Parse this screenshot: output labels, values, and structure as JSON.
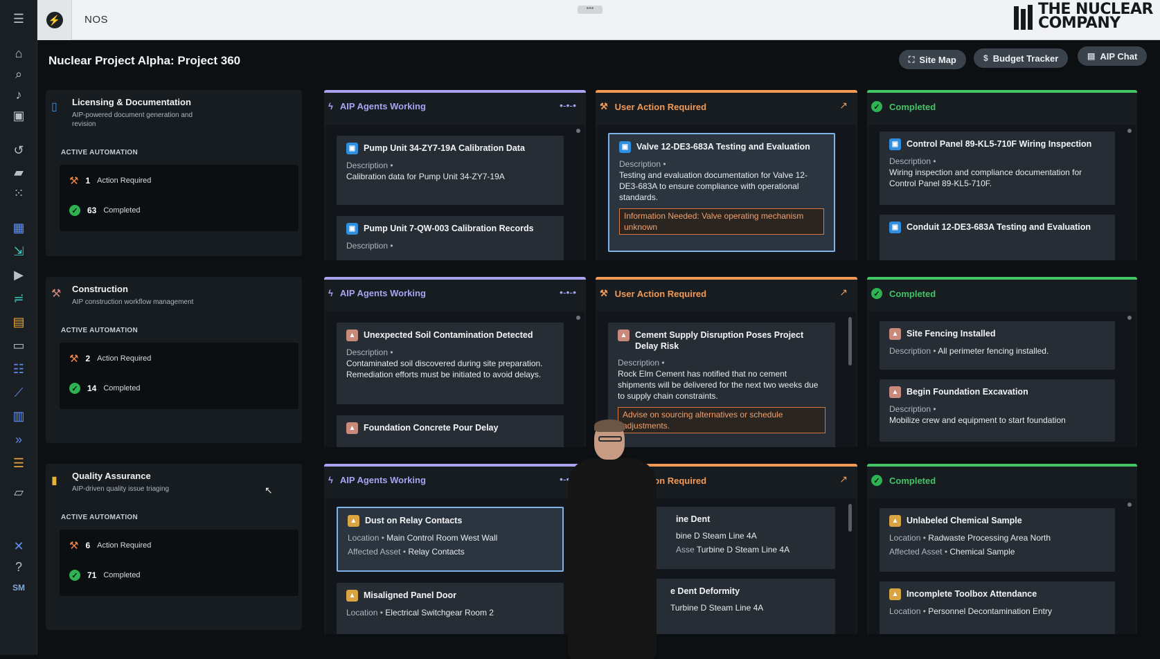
{
  "topbar": {
    "app_name": "NOS",
    "brand_line1": "THE NUCLEAR",
    "brand_line2": "COMPANY"
  },
  "page": {
    "title": "Nuclear Project Alpha: Project 360",
    "buttons": [
      {
        "label": "Site Map",
        "icon": "map-icon"
      },
      {
        "label": "Budget Tracker",
        "icon": "dollar-icon"
      },
      {
        "label": "AIP Chat",
        "icon": "chat-icon"
      }
    ]
  },
  "common": {
    "active_automation": "ACTIVE AUTOMATION",
    "action_required": "Action Required",
    "completed": "Completed",
    "col_agents": "AIP Agents Working",
    "col_user": "User Action Required",
    "col_completed": "Completed"
  },
  "sections": [
    {
      "title": "Licensing & Documentation",
      "subtitle": "AIP-powered document generation and revision",
      "action_count": "1",
      "completed_count": "63",
      "agents": [
        {
          "title": "Pump Unit 34-ZY7-19A Calibration Data",
          "label": "Description •",
          "value": "Calibration data for Pump Unit 34-ZY7-19A"
        },
        {
          "title": "Pump Unit 7-QW-003 Calibration Records",
          "label": "Description •",
          "value": ""
        }
      ],
      "user": [
        {
          "title": "Valve 12-DE3-683A Testing and Evaluation",
          "label": "Description •",
          "value": "Testing and evaluation documentation for Valve 12-DE3-683A to ensure compliance with operational standards.",
          "note": "Information Needed: Valve operating mechanism unknown"
        }
      ],
      "done": [
        {
          "title": "Control Panel 89-KL5-710F Wiring Inspection",
          "label": "Description •",
          "value": "Wiring inspection and compliance documentation for Control Panel 89-KL5-710F."
        },
        {
          "title": "Conduit 12-DE3-683A Testing and Evaluation",
          "label": "",
          "value": ""
        }
      ]
    },
    {
      "title": "Construction",
      "subtitle": "AIP construction workflow management",
      "action_count": "2",
      "completed_count": "14",
      "agents": [
        {
          "title": "Unexpected Soil Contamination Detected",
          "label": "Description •",
          "value": "Contaminated soil discovered during site preparation. Remediation efforts must be initiated to avoid delays."
        },
        {
          "title": "Foundation Concrete Pour Delay",
          "label": "",
          "value": ""
        }
      ],
      "user": [
        {
          "title": "Cement Supply Disruption Poses Project Delay Risk",
          "label": "Description •",
          "value": "Rock Elm Cement has notified that no cement shipments will be delivered for the next two weeks due to supply chain constraints.",
          "note": "Advise on sourcing alternatives or schedule adjustments."
        }
      ],
      "done": [
        {
          "title": "Site Fencing Installed",
          "label": "Description •",
          "value": "All perimeter fencing installed."
        },
        {
          "title": "Begin Foundation Excavation",
          "label": "Description •",
          "value": "Mobilize crew and equipment to start foundation"
        }
      ]
    },
    {
      "title": "Quality Assurance",
      "subtitle": "AIP-driven quality issue triaging",
      "action_count": "6",
      "completed_count": "71",
      "agents": [
        {
          "title": "Dust on Relay Contacts",
          "loc_label": "Location •",
          "loc": "Main Control Room West Wall",
          "asset_label": "Affected Asset •",
          "asset": "Relay Contacts"
        },
        {
          "title": "Misaligned Panel Door",
          "loc_label": "Location •",
          "loc": "Electrical Switchgear Room 2"
        }
      ],
      "user": [
        {
          "title": "ine Dent",
          "loc_label": "",
          "loc": "bine D Steam Line 4A",
          "asset_label": "Asse",
          "asset": "Turbine D Steam Line 4A"
        },
        {
          "title": "e Dent Deformity",
          "loc_label": "",
          "loc": "Turbine D Steam Line 4A"
        }
      ],
      "done": [
        {
          "title": "Unlabeled Chemical Sample",
          "loc_label": "Location •",
          "loc": "Radwaste Processing Area North",
          "asset_label": "Affected Asset •",
          "asset": "Chemical Sample"
        },
        {
          "title": "Incomplete Toolbox Attendance",
          "loc_label": "Location •",
          "loc": "Personnel Decontamination Entry"
        }
      ]
    }
  ],
  "rail": {
    "footer_initials": "SM"
  },
  "colors": {
    "agents": "#a9a3f2",
    "user": "#f29a56",
    "completed": "#43c465",
    "doc_badge": "#2f8fe0"
  }
}
